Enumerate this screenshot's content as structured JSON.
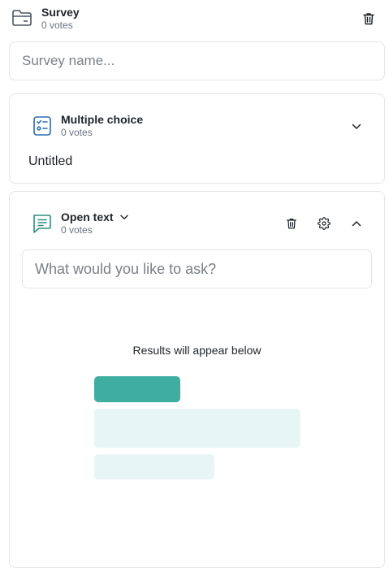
{
  "survey": {
    "title": "Survey",
    "votes": "0 votes",
    "name_placeholder": "Survey name..."
  },
  "questions": [
    {
      "type_label": "Multiple choice",
      "votes": "0 votes",
      "title": "Untitled",
      "icon": "checklist-icon",
      "expanded": false
    },
    {
      "type_label": "Open text",
      "votes": "0 votes",
      "placeholder": "What would you like to ask?",
      "icon": "chat-lines-icon",
      "expanded": true,
      "results_text": "Results will appear below"
    }
  ],
  "colors": {
    "accent": "#3fada0",
    "accent_light": "#e7f6f4",
    "multiple_choice_icon": "#2b6cb0",
    "open_text_icon": "#2f8f7f",
    "border": "#e3e5e8"
  }
}
